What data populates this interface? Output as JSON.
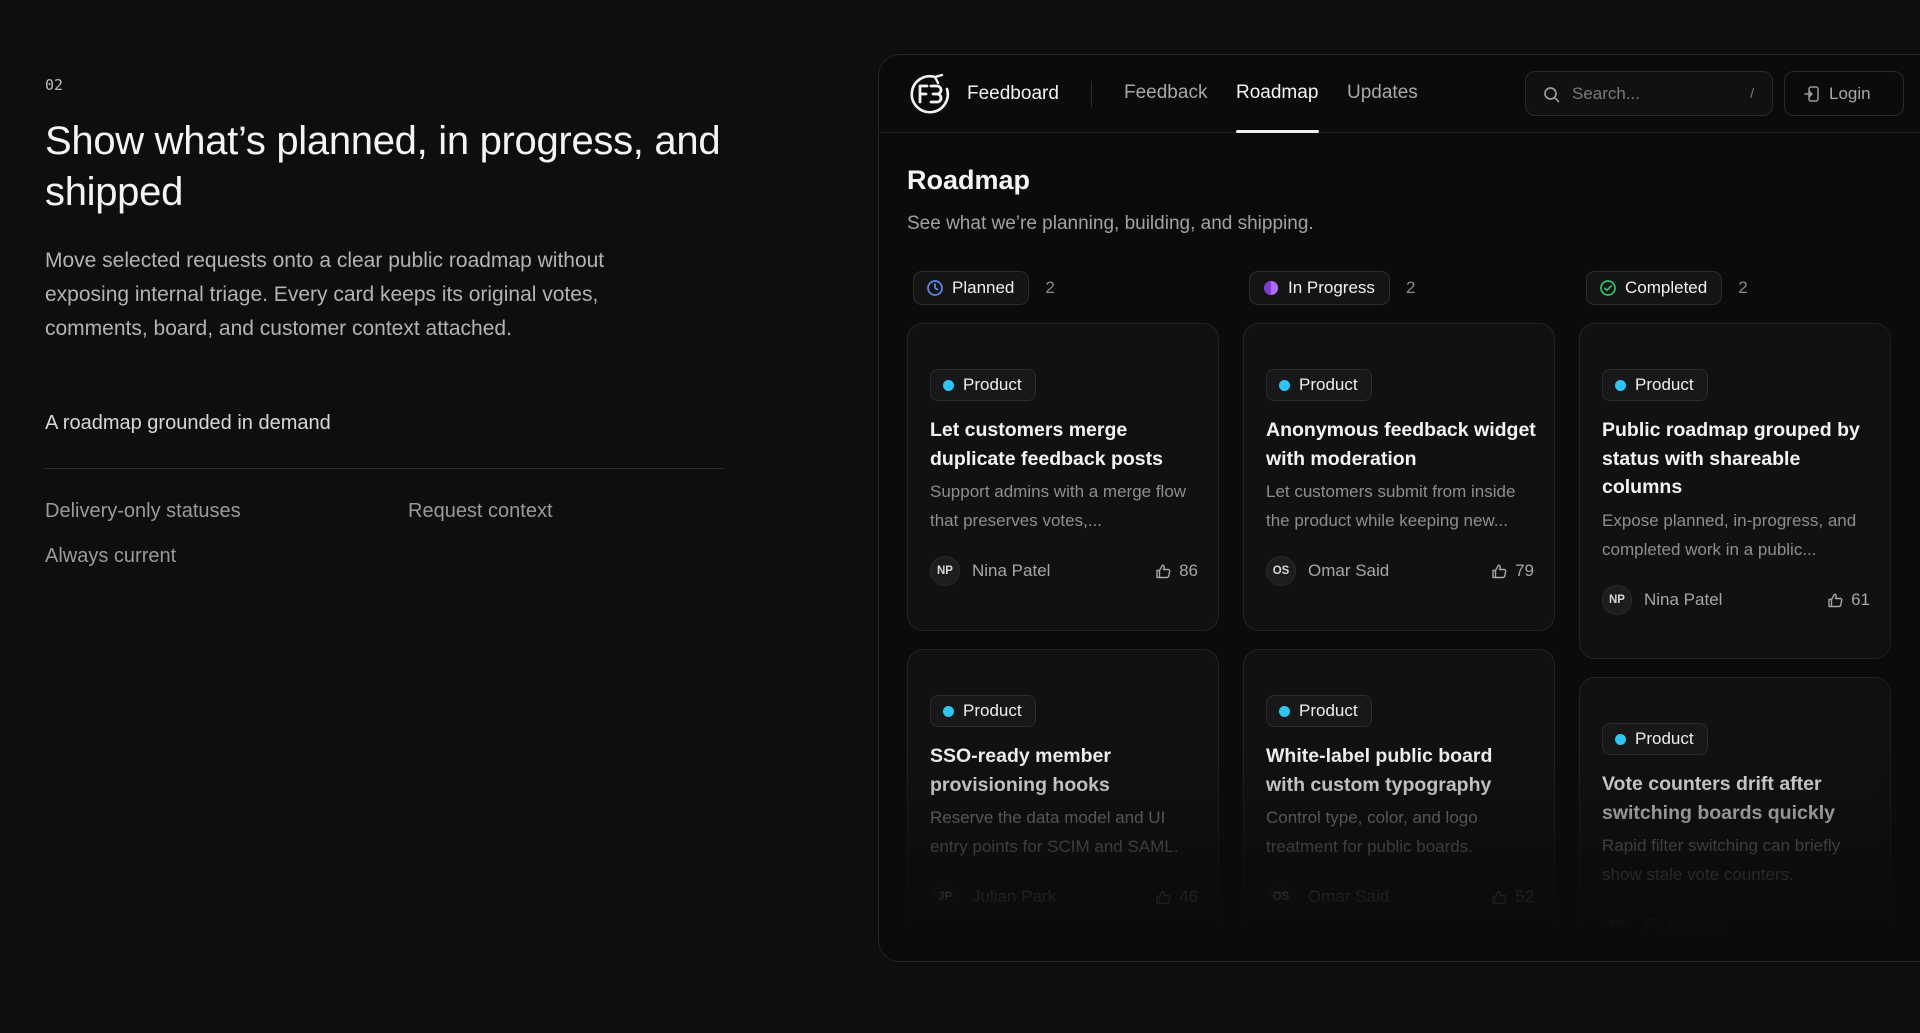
{
  "intro": {
    "step": "02",
    "headline": "Show what’s planned, in progress, and shipped",
    "description": "Move selected requests onto a clear public roadmap without exposing internal triage. Every card keeps its original votes, comments, board, and customer context attached.",
    "section_label": "A roadmap grounded in demand",
    "features": [
      "Delivery-only statuses",
      "Request context",
      "Always current"
    ]
  },
  "app": {
    "brand": "Feedboard",
    "logo_icon": "feedboard-logo-icon",
    "nav": [
      "Feedback",
      "Roadmap",
      "Updates"
    ],
    "active_nav": "Roadmap",
    "search": {
      "placeholder": "Search...",
      "shortcut": "/"
    },
    "login_label": "Login",
    "page_title": "Roadmap",
    "page_subtitle": "See what we’re planning, building, and shipping.",
    "accent_tag_color": "#2ec6f0",
    "columns": [
      {
        "status": "Planned",
        "count": "2",
        "icon": "clock-icon",
        "icon_color": "#5b8def",
        "cards": [
          {
            "tag": "Product",
            "title": "Let customers merge duplicate feedback posts",
            "description": "Support admins with a merge flow that preserves votes,...",
            "initials": "NP",
            "author": "Nina Patel",
            "votes": "86"
          },
          {
            "tag": "Product",
            "title": "SSO-ready member provisioning hooks",
            "description": "Reserve the data model and UI entry points for SCIM and SAML.",
            "initials": "JP",
            "author": "Julian Park",
            "votes": "46"
          }
        ]
      },
      {
        "status": "In Progress",
        "count": "2",
        "icon": "half-circle-icon",
        "icon_color": "#a64dff",
        "cards": [
          {
            "tag": "Product",
            "title": "Anonymous feedback widget with moderation",
            "description": "Let customers submit from inside the product while keeping new...",
            "initials": "OS",
            "author": "Omar Said",
            "votes": "79"
          },
          {
            "tag": "Product",
            "title": "White-label public board with custom typography",
            "description": "Control type, color, and logo treatment for public boards.",
            "initials": "OS",
            "author": "Omar Said",
            "votes": "52"
          }
        ]
      },
      {
        "status": "Completed",
        "count": "2",
        "icon": "check-circle-icon",
        "icon_color": "#34c46a",
        "cards": [
          {
            "tag": "Product",
            "title": "Public roadmap grouped by status with shareable columns",
            "description": "Expose planned, in-progress, and completed work in a public...",
            "initials": "NP",
            "author": "Nina Patel",
            "votes": "61"
          },
          {
            "tag": "Product",
            "title": "Vote counters drift after switching boards quickly",
            "description": "Rapid filter switching can briefly show stale vote counters.",
            "initials": "ER",
            "author": "Eli Romero",
            "votes": ""
          }
        ]
      }
    ]
  }
}
